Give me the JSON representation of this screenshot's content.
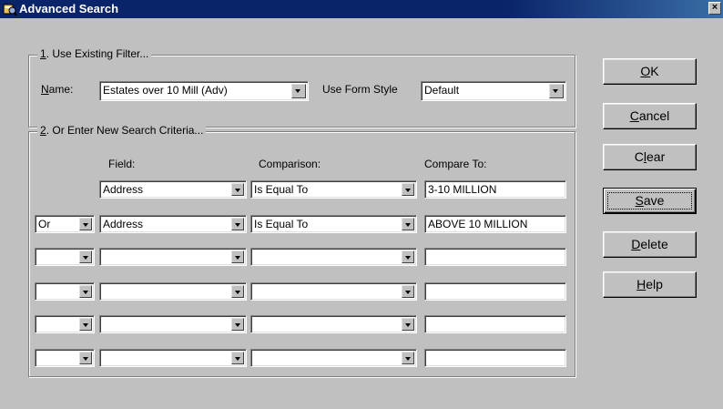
{
  "window": {
    "title": "Advanced Search",
    "close_label": "×"
  },
  "group1": {
    "legend_accel": "1",
    "legend_rest": ". Use Existing Filter...",
    "name_label_accel": "N",
    "name_label_rest": "ame:",
    "name_value": "Estates over 10 Mill (Adv)",
    "form_style_label": "Use Form Style",
    "form_style_value": "Default"
  },
  "group2": {
    "legend_accel": "2",
    "legend_rest": ". Or Enter New Search Criteria...",
    "headers": {
      "field": "Field:",
      "comparison": "Comparison:",
      "compare_to": "Compare To:"
    },
    "rows": [
      {
        "connector": null,
        "field": "Address",
        "comparison": "Is Equal To",
        "compare_to": "3-10 MILLION"
      },
      {
        "connector": "Or",
        "field": "Address",
        "comparison": "Is Equal To",
        "compare_to": "ABOVE 10 MILLION"
      },
      {
        "connector": "",
        "field": "",
        "comparison": "",
        "compare_to": ""
      },
      {
        "connector": "",
        "field": "",
        "comparison": "",
        "compare_to": ""
      },
      {
        "connector": "",
        "field": "",
        "comparison": "",
        "compare_to": ""
      },
      {
        "connector": "",
        "field": "",
        "comparison": "",
        "compare_to": ""
      }
    ]
  },
  "buttons": {
    "ok": {
      "accel": "O",
      "rest": "K"
    },
    "cancel": {
      "accel": "C",
      "rest": "ancel"
    },
    "clear": {
      "pre": "C",
      "accel": "l",
      "rest": "ear"
    },
    "save": {
      "accel": "S",
      "rest": "ave"
    },
    "delete": {
      "accel": "D",
      "rest": "elete"
    },
    "help": {
      "accel": "H",
      "rest": "elp"
    }
  }
}
